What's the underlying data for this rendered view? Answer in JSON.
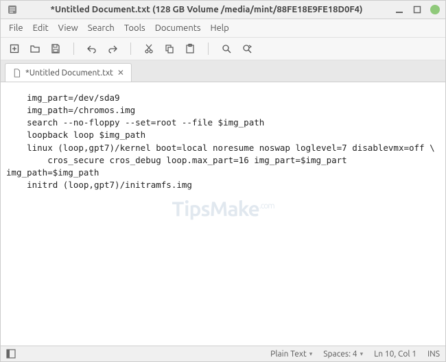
{
  "window": {
    "title": "*Untitled Document.txt (128 GB Volume /media/mint/88FE18E9FE18D0F4)"
  },
  "menubar": {
    "items": [
      "File",
      "Edit",
      "View",
      "Search",
      "Tools",
      "Documents",
      "Help"
    ]
  },
  "tab": {
    "label": "*Untitled Document.txt"
  },
  "editor": {
    "content": "    img_part=/dev/sda9\n    img_path=/chromos.img\n    search --no-floppy --set=root --file $img_path\n    loopback loop $img_path\n    linux (loop,gpt7)/kernel boot=local noresume noswap loglevel=7 disablevmx=off \\\n        cros_secure cros_debug loop.max_part=16 img_part=$img_part img_path=$img_path\n    initrd (loop,gpt7)/initramfs.img"
  },
  "statusbar": {
    "syntax": "Plain Text",
    "spaces": "Spaces: 4",
    "position": "Ln 10, Col 1",
    "insert_mode": "INS"
  },
  "watermark": {
    "text": "TipsMake",
    "suffix": ".com"
  }
}
